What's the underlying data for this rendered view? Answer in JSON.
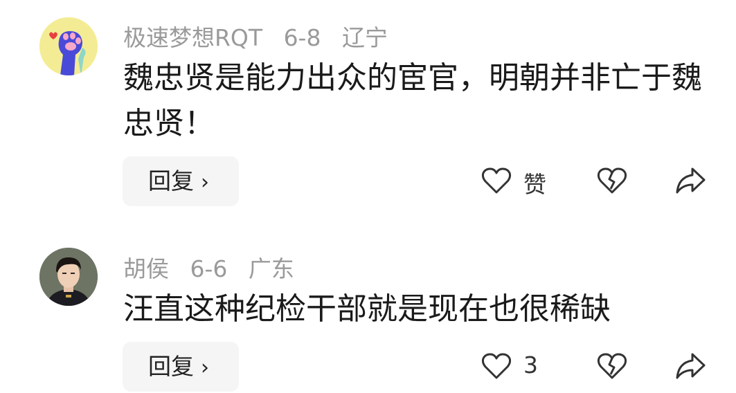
{
  "comments": [
    {
      "author": "极速梦想RQT",
      "date": "6-8",
      "location": "辽宁",
      "text": "魏忠贤是能力出众的宦官，明朝并非亡于魏忠贤！",
      "reply_label": "回复",
      "reply_chevron": "›",
      "like_label": "赞",
      "avatar_icon": "paw-icon"
    },
    {
      "author": "胡侯",
      "date": "6-6",
      "location": "广东",
      "text": "汪直这种纪检干部就是现在也很稀缺",
      "reply_label": "回复",
      "reply_chevron": "›",
      "like_label": "3",
      "avatar_icon": "person-portrait"
    }
  ],
  "colors": {
    "meta_text": "#9a9a9a",
    "body_text": "#1a1a1a",
    "button_bg": "#f5f5f5",
    "icon_stroke": "#333333"
  }
}
